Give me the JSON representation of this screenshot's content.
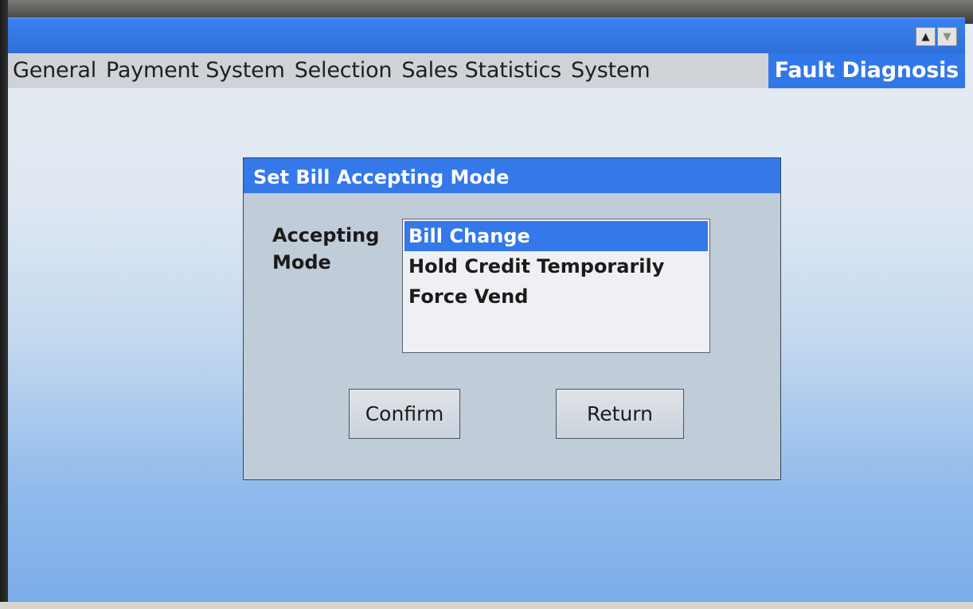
{
  "tabs": [
    {
      "label": "General"
    },
    {
      "label": "Payment System"
    },
    {
      "label": "Selection"
    },
    {
      "label": "Sales Statistics"
    },
    {
      "label": "System"
    },
    {
      "label": "Fault Diagnosis",
      "active": true
    }
  ],
  "scroll": {
    "up_icon": "triangle-up-icon",
    "down_icon": "triangle-down-icon",
    "up_glyph": "▲",
    "down_glyph": "▼"
  },
  "dialog": {
    "title": "Set Bill Accepting Mode",
    "field_label": "Accepting Mode",
    "options": [
      {
        "label": "Bill Change",
        "selected": true
      },
      {
        "label": "Hold Credit Temporarily",
        "selected": false
      },
      {
        "label": "Force Vend",
        "selected": false
      }
    ],
    "confirm_label": "Confirm",
    "return_label": "Return"
  },
  "colors": {
    "accent": "#3478ea",
    "tab_strip": "#cfd3d8",
    "dialog_body": "#c1ccd9"
  }
}
